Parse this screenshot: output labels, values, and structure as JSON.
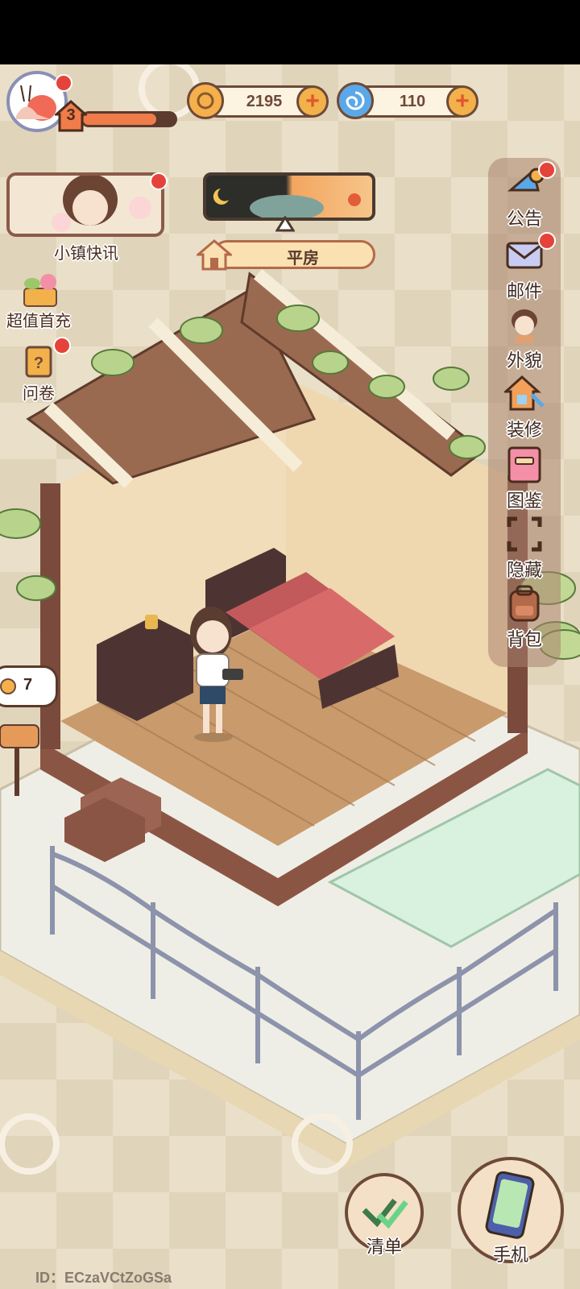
{
  "hud": {
    "level": "3",
    "xp_fraction": 0.8,
    "coins": "2195",
    "gems": "110",
    "plus": "+"
  },
  "news": {
    "label": "小镇快讯"
  },
  "house": {
    "name": "平房"
  },
  "left_menu": [
    {
      "label": "超值首充",
      "icon": "gift-flower-icon"
    },
    {
      "label": "问卷",
      "icon": "questionnaire-icon"
    }
  ],
  "side_menu": [
    {
      "label": "公告",
      "icon": "announcement-icon"
    },
    {
      "label": "邮件",
      "icon": "mail-icon"
    },
    {
      "label": "外貌",
      "icon": "appearance-icon"
    },
    {
      "label": "装修",
      "icon": "renovate-icon"
    },
    {
      "label": "图鉴",
      "icon": "catalog-icon"
    },
    {
      "label": "隐藏",
      "icon": "hide-icon"
    },
    {
      "label": "背包",
      "icon": "backpack-icon"
    }
  ],
  "notification": {
    "count": "7"
  },
  "bottom": {
    "list_label": "清单",
    "phone_label": "手机"
  },
  "player_id": "ID：ECzaVCtZoGSa",
  "colors": {
    "background": "#eadfc8",
    "accent_orange": "#f07c4a",
    "outline_brown": "#6e4a38",
    "badge_red": "#e5433a"
  }
}
